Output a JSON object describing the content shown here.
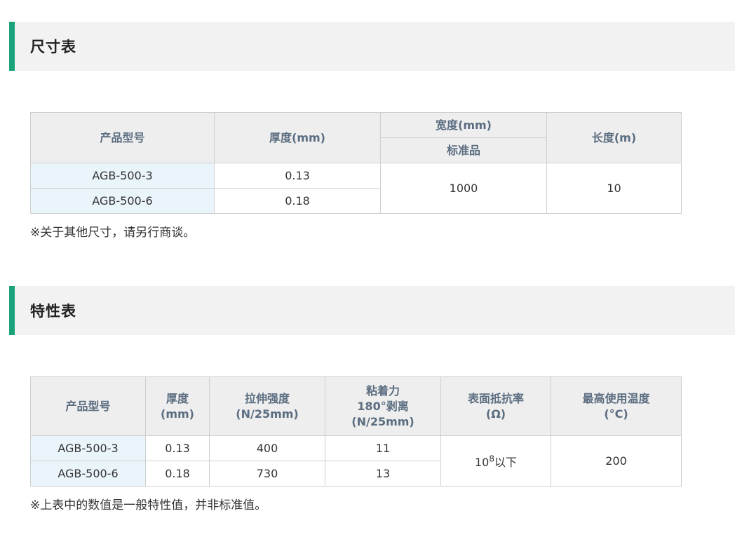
{
  "size_section": {
    "title": "尺寸表",
    "headers": {
      "model": "产品型号",
      "thickness": "厚度(mm)",
      "width": "宽度(mm)",
      "width_sub": "标准品",
      "length": "长度(m)"
    },
    "rows": [
      {
        "model": "AGB-500-3",
        "thickness": "0.13"
      },
      {
        "model": "AGB-500-6",
        "thickness": "0.18"
      }
    ],
    "width_value": "1000",
    "length_value": "10",
    "note": "※关于其他尺寸，请另行商谈。"
  },
  "property_section": {
    "title": "特性表",
    "headers": {
      "model": "产品型号",
      "thickness_l1": "厚度",
      "thickness_l2": "(mm)",
      "tensile_l1": "拉伸强度",
      "tensile_l2": "(N/25mm)",
      "adhesion_l1": "粘着力",
      "adhesion_l2": "180°剥离",
      "adhesion_l3": "(N/25mm)",
      "resistivity_l1": "表面抵抗率",
      "resistivity_l2": "(Ω)",
      "temp_l1": "最高使用温度",
      "temp_l2": "(°C)"
    },
    "rows": [
      {
        "model": "AGB-500-3",
        "thickness": "0.13",
        "tensile": "400",
        "adhesion": "11"
      },
      {
        "model": "AGB-500-6",
        "thickness": "0.18",
        "tensile": "730",
        "adhesion": "13"
      }
    ],
    "resistivity": {
      "base": "10",
      "exponent": "8",
      "suffix": "以下"
    },
    "max_temp": "200",
    "note": "※上表中的数值是一般特性值，并非标准值。"
  },
  "colors": {
    "accent": "#1aa37a",
    "header_bg": "#eeeeee",
    "header_text": "#5b6d80",
    "model_cell_bg": "#eaf4fb",
    "border": "#cfcfcf"
  }
}
